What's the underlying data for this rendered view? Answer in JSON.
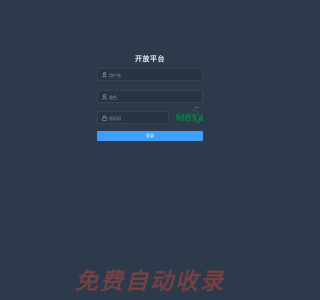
{
  "header": {
    "title": "开放平台"
  },
  "login_form": {
    "username_placeholder": "用户名",
    "role_value": "角色",
    "captcha_placeholder": "验证码",
    "login_button_label": "登录",
    "icons": {
      "username": "user-icon",
      "role": "role-icon",
      "captcha": "captcha-icon",
      "role_dropdown": "chevron-down-icon"
    }
  },
  "captcha_image": {
    "text": "MbXa"
  },
  "watermark": {
    "text": "免费自动收录"
  },
  "colors": {
    "background": "#2d3a4b",
    "field_bg": "#283443",
    "placeholder": "#889aa4",
    "button": "#409eff",
    "captcha_text": "#0c7a4a",
    "watermark": "#ef4e36"
  }
}
